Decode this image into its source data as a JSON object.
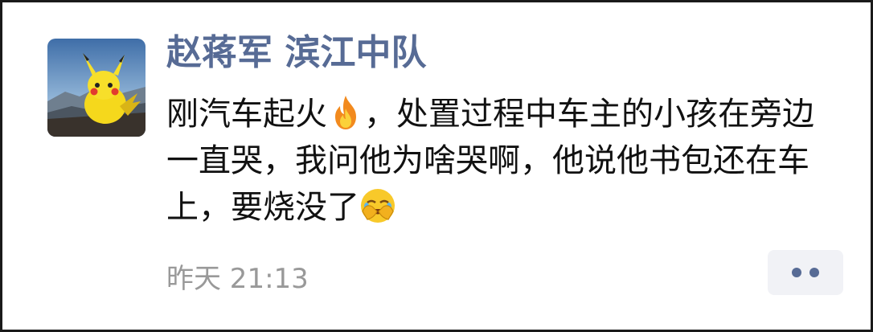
{
  "post": {
    "username": "赵蒋军 滨江中队",
    "message": {
      "part1": "刚汽车起火",
      "emoji1": "fire-emoji",
      "part2": "，处置过程中车主的小孩在旁边一直哭，我问他为啥哭啊，他说他书包还在车上，要烧没了",
      "emoji2": "facepalm-laughing-emoji"
    },
    "timestamp": "昨天 21:13",
    "avatar": "pikachu-avatar",
    "more_icon": "more-dots-icon"
  },
  "colors": {
    "username": "#576b95",
    "text": "#111111",
    "timestamp": "#999999",
    "more_bg": "#f1f2f6"
  }
}
